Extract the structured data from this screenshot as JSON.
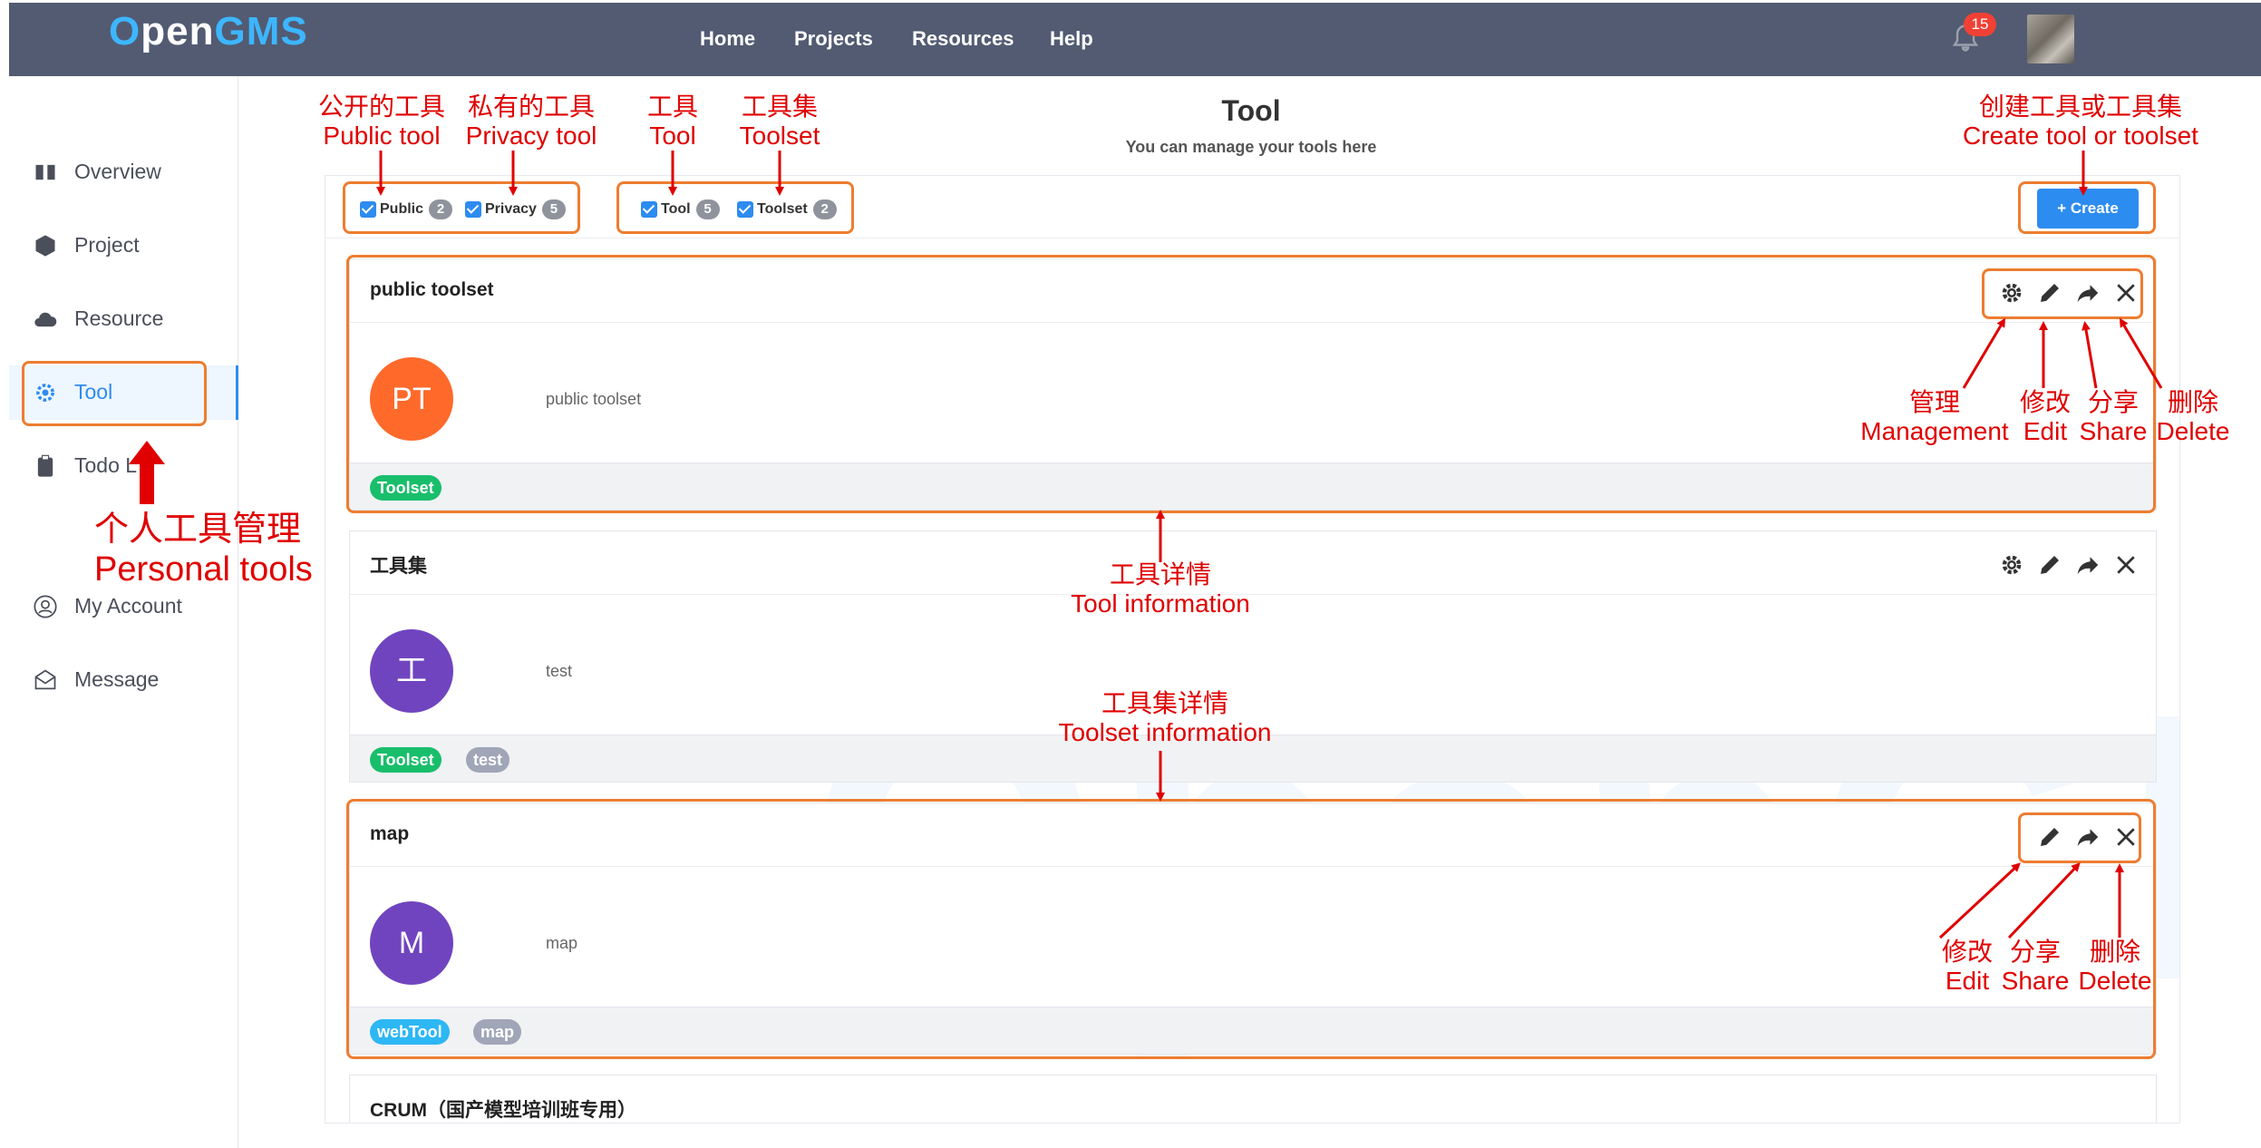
{
  "brand": {
    "logo_o": "O",
    "logo_pen": "pen",
    "logo_gms": "GMS"
  },
  "topnav": {
    "home": "Home",
    "projects": "Projects",
    "resources": "Resources",
    "help": "Help",
    "notification_count": "15"
  },
  "sidebar": {
    "items": [
      {
        "label": "Overview",
        "icon": "book-icon"
      },
      {
        "label": "Project",
        "icon": "cube-icon"
      },
      {
        "label": "Resource",
        "icon": "cloud-icon"
      },
      {
        "label": "Tool",
        "icon": "gear-icon"
      },
      {
        "label": "Todo L",
        "icon": "clipboard-icon"
      },
      {
        "label": "My Account",
        "icon": "user-icon"
      },
      {
        "label": "Message",
        "icon": "mail-icon"
      }
    ]
  },
  "header": {
    "title": "Tool",
    "subtitle": "You can manage your tools here"
  },
  "filters": {
    "public": {
      "label": "Public",
      "count": "2"
    },
    "privacy": {
      "label": "Privacy",
      "count": "5"
    },
    "tool": {
      "label": "Tool",
      "count": "5"
    },
    "toolset": {
      "label": "Toolset",
      "count": "2"
    }
  },
  "create_button": "+  Create",
  "cards": [
    {
      "title": "public toolset",
      "initials": "PT",
      "description": "public toolset",
      "tags": [
        "Toolset"
      ]
    },
    {
      "title": "工具集",
      "initials": "工",
      "description": "test",
      "tags": [
        "Toolset",
        "test"
      ]
    },
    {
      "title": "map",
      "initials": "M",
      "description": "map",
      "tags": [
        "webTool",
        "map"
      ]
    },
    {
      "title": "CRUM（国产模型培训班专用）"
    }
  ],
  "annotations": {
    "public_tool": "公开的工具\nPublic tool",
    "privacy_tool": "私有的工具\nPrivacy tool",
    "tool": "工具\nTool",
    "toolset": "工具集\nToolset",
    "create": "创建工具或工具集\nCreate tool or toolset",
    "personal_tools": "个人工具管理\nPersonal tools",
    "tool_info": "工具详情\nTool information",
    "toolset_info": "工具集详情\nToolset information",
    "management": "管理\nManagement",
    "edit": "修改\nEdit",
    "share": "分享\nShare",
    "delete": "删除\nDelete"
  },
  "colors": {
    "topbar": "#525b72",
    "accent": "#2d8cf0",
    "annotation": "#e00000",
    "highlight_box": "#ed7d31",
    "toolset_tag": "#19be6b",
    "webtool_tag": "#2db7f5",
    "grey_tag": "#a0a6b8"
  }
}
